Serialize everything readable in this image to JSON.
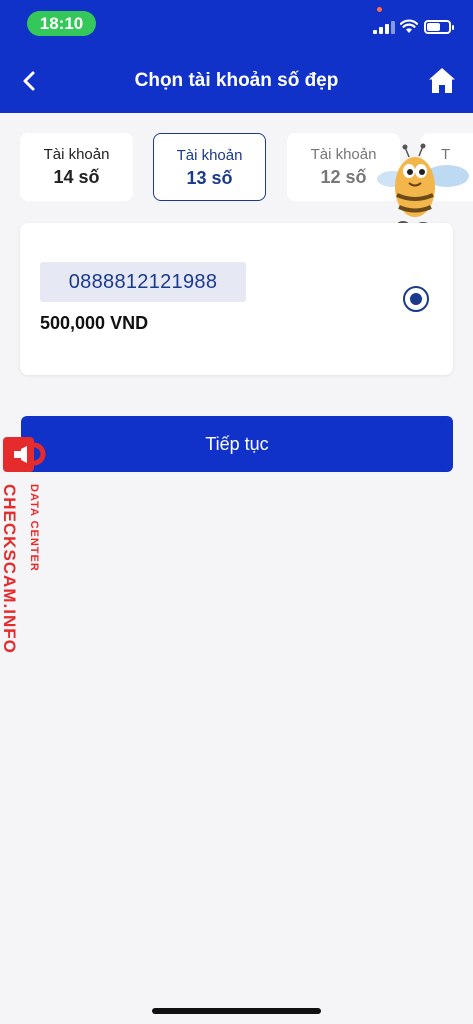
{
  "status_bar": {
    "time": "18:10"
  },
  "header": {
    "title": "Chọn tài khoản số đẹp"
  },
  "tabs": [
    {
      "label": "Tài khoản",
      "value": "14 số",
      "selected": false
    },
    {
      "label": "Tài khoản",
      "value": "13 số",
      "selected": true
    },
    {
      "label": "Tài khoản",
      "value": "12 số",
      "selected": false
    },
    {
      "label": "T",
      "value": ""
    }
  ],
  "selected_account": {
    "number": "0888812121988",
    "price": "500,000 VND",
    "radio_selected": true
  },
  "continue_button": {
    "label": "Tiếp tục"
  },
  "watermark": {
    "main": "CHECKSCAM.INFO",
    "sub": "DATA CENTER"
  },
  "colors": {
    "brand": "#1132c8",
    "accent": "#1b3a8e",
    "time_pill": "#34c759",
    "watermark": "#e52b2b"
  }
}
